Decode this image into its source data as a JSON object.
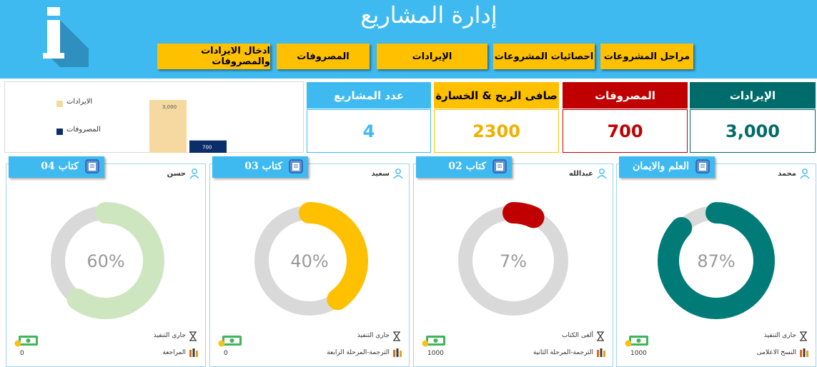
{
  "header": {
    "title": "إدارة المشاريع",
    "nav": [
      "مراحل المشروعات",
      "احصائيات المشروعات",
      "الإيرادات",
      "المصروفات",
      "ادخال الايرادات والمصروفات"
    ]
  },
  "kpis": [
    {
      "label": "الإيرادات",
      "value": "3,000",
      "head_color": "#006b6b",
      "value_color": "#006b6b"
    },
    {
      "label": "المصروفات",
      "value": "700",
      "head_color": "#c00000",
      "value_color": "#c00000"
    },
    {
      "label": "صافى الربح & الخسارة",
      "value": "2300",
      "head_color": "#ffc000",
      "value_color": "#f0b000"
    },
    {
      "label": "عدد المشاريع",
      "value": "4",
      "head_color": "#3ebaf0",
      "value_color": "#3ebaf0"
    }
  ],
  "chart_data": {
    "type": "bar",
    "categories": [
      "الايرادات",
      "المصروفات"
    ],
    "values": [
      3000,
      700
    ],
    "labels": [
      "3,000",
      "700"
    ],
    "colors": [
      "#f5d9a0",
      "#0b2e6b"
    ],
    "legend_position": "left"
  },
  "projects": [
    {
      "tag": "العلم والايمان",
      "person": "محمد",
      "percent": 87,
      "percent_label": "87%",
      "color": "#007b78",
      "status": "جارى التنفيذ",
      "stage": "النسخ الاعلامى",
      "amount": "1000"
    },
    {
      "tag": "كتاب 02",
      "person": "عبدالله",
      "percent": 7,
      "percent_label": "7%",
      "color": "#c00000",
      "status": "ألغى الكتاب",
      "stage": "الترجمة-المرحلة الثانية",
      "amount": "1000"
    },
    {
      "tag": "كتاب 03",
      "person": "سعيد",
      "percent": 40,
      "percent_label": "40%",
      "color": "#ffc000",
      "status": "جارى التنفيذ",
      "stage": "الترجمة-المرحلة الرابعة",
      "amount": "0"
    },
    {
      "tag": "كتاب 04",
      "person": "حسن",
      "percent": 60,
      "percent_label": "60%",
      "color": "#cde6bf",
      "status": "جارى التنفيذ",
      "stage": "المراجعة",
      "amount": "0"
    }
  ]
}
